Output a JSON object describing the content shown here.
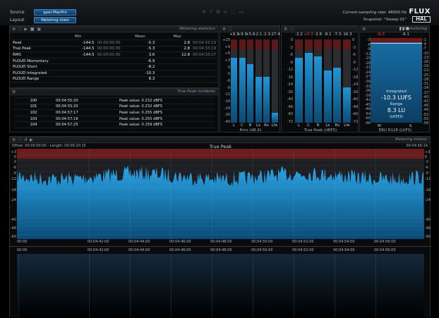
{
  "topbar": {
    "source_label": "Source",
    "source_value": "gael-MacPro",
    "layout_label": "Layout",
    "layout_value": "Metering stats",
    "sampling": "Current sampling rate: 48000 Hz",
    "snapshot": "Snapshot: \"Sweep 01\"",
    "logo_top": "FLUX",
    "logo_bottom": "HAL"
  },
  "stats": {
    "title": "Metering statistics",
    "headers": [
      "",
      "Min",
      "",
      "Mean",
      "",
      "Max",
      ""
    ],
    "rows": [
      {
        "label": "Peak",
        "min": "-144.5",
        "min_t": "00:00:00:00",
        "mean": "-5.3",
        "max": "2.8",
        "max_t": "00:04:33:19"
      },
      {
        "label": "True Peak",
        "min": "-144.5",
        "min_t": "00:00:00:00",
        "mean": "-5.3",
        "max": "2.8",
        "max_t": "00:04:33:19"
      },
      {
        "label": "RMS",
        "min": "-144.5",
        "min_t": "00:00:00:00",
        "mean": "3.6",
        "max": "12.8",
        "max_t": "00:04:33:27"
      },
      {
        "label": "PLOUD Momentary",
        "min": "",
        "min_t": "",
        "mean": "-6.9",
        "max": "",
        "max_t": ""
      },
      {
        "label": "PLOUD Short",
        "min": "",
        "min_t": "",
        "mean": "-8.2",
        "max": "",
        "max_t": ""
      },
      {
        "label": "PLOUD Integrated",
        "min": "",
        "min_t": "",
        "mean": "-10.3",
        "max": "",
        "max_t": ""
      },
      {
        "label": "PLOUD Range",
        "min": "",
        "min_t": "",
        "mean": "8.3",
        "max": "",
        "max_t": ""
      }
    ]
  },
  "incidents": {
    "title": "True Peak incidents",
    "rows": [
      {
        "n": "100",
        "t": "00:04:55:20",
        "v": "Peak value: 0.232 dBFS"
      },
      {
        "n": "101",
        "t": "00:04:55:20",
        "v": "Peak value: 0.232 dBFS"
      },
      {
        "n": "102",
        "t": "00:04:57:17",
        "v": "Peak value: 0.255 dBFS"
      },
      {
        "n": "103",
        "t": "00:04:57:18",
        "v": "Peak value: 0.255 dBFS"
      },
      {
        "n": "104",
        "t": "00:04:57:25",
        "v": "Peak value: 0.159 dBFS"
      }
    ]
  },
  "rms_meter": {
    "label": "Rms (dB A)",
    "values": [
      "+9.3",
      "+9.3",
      "+5.6",
      "-2.1",
      "-2.3",
      "-27.4"
    ],
    "peak_label": "+20",
    "channels": [
      "L",
      "C",
      "R",
      "Ls",
      "Rs",
      "Lfe"
    ],
    "scale": [
      "+20",
      "+9",
      "+6",
      "+3",
      "0",
      "-3",
      "-6",
      "-9",
      "-12",
      "-18",
      "-24",
      "-30",
      "-40"
    ],
    "levels": [
      0.78,
      0.78,
      0.7,
      0.55,
      0.55,
      0.12
    ]
  },
  "tp_meter": {
    "label": "True Peak (dBFS)",
    "values": [
      "-2.2",
      "+0.3",
      "-2.8",
      "-8.1",
      "-7.3",
      "-16.3"
    ],
    "channels": [
      "L",
      "C",
      "R",
      "Ls",
      "Rs",
      "Lfe"
    ],
    "scale": [
      "0",
      "-3",
      "-6",
      "-9",
      "-12",
      "-18",
      "-24",
      "-30",
      "-40",
      "-48",
      "-60",
      "-72"
    ],
    "levels": [
      0.78,
      0.84,
      0.8,
      0.63,
      0.66,
      0.42
    ]
  },
  "loudness_meter": {
    "title": "RMS metering",
    "label": "EBU R128 (LUFS)",
    "m_value": "-6.3",
    "s_value": "-6.1",
    "integrated_label": "Integrated",
    "integrated_value": "-10.3 LUFS",
    "range_label": "Range",
    "range_value": "8.3 LU",
    "gated": "GATED",
    "m_label": "M",
    "s_label": "S",
    "scale_left": [
      "-3",
      "-6",
      "-9",
      "-12",
      "-15",
      "-18",
      "-21",
      "-24",
      "-27",
      "-30",
      "-33",
      "-36",
      "-39",
      "-42",
      "-45",
      "-48",
      "-54",
      "-60",
      "-66"
    ],
    "scale_right": [
      "-1",
      "-4",
      "-7",
      "-10",
      "-13",
      "-16",
      "-19",
      "-22",
      "-25",
      "-28",
      "-31",
      "-34",
      "-37",
      "-40",
      "-43",
      "-46",
      "-49",
      "-52",
      "-55",
      "-58"
    ]
  },
  "history": {
    "title": "Metering history",
    "graph_title": "True Peak",
    "offset": "Offset: 00:00:00:00 - Length: 00:00:20:15",
    "end_time": "00:04:56:19",
    "scale": [
      "+3",
      "0",
      "-3",
      "-6",
      "-9",
      "-12",
      "-18",
      "-24",
      "-40",
      "-48",
      "-60"
    ],
    "timeline": [
      "00:00",
      "00:04:42:00",
      "00:04:44:00",
      "00:04:46:00",
      "00:04:48:00",
      "00:04:50:00",
      "00:04:52:00",
      "00:04:54:00",
      "00:04:56:00"
    ],
    "timeline2": [
      "00:00",
      "00:04:42:00",
      "00:04:44:00",
      "00:04:46:00",
      "00:04:48:00",
      "00:04:50:00",
      "00:04:52:00",
      "00:04:54:00",
      "00:04:56:00"
    ]
  },
  "colors": {
    "accent": "#2f86c8",
    "meter_blue": "#1f8fd0",
    "over_red": "#7a1e1e"
  }
}
